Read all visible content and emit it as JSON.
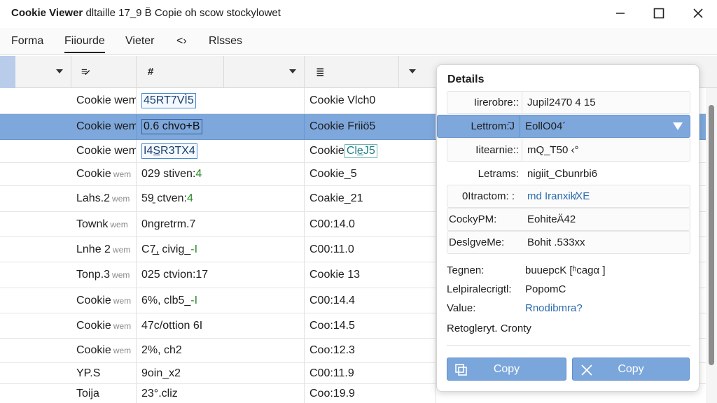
{
  "window": {
    "title_bold": "Cookie Viewer",
    "title_rest": " dltaille 17_9 B̈ Copie oh scow stockylowet"
  },
  "menu": [
    "Forma",
    "Fiiourde",
    "Vieter",
    "<›",
    "Rlsses"
  ],
  "grid": {
    "headers": [
      {
        "icon": "",
        "icon_name": "sort-caret-icon"
      },
      {
        "icon": "≡̷",
        "icon_name": "filter-icon"
      },
      {
        "icon": "#",
        "icon_name": "hash-icon"
      },
      {
        "icon": "≣",
        "icon_name": "funnel-icon"
      }
    ],
    "rows": [
      {
        "name": "Cookie wem",
        "name_sub": "",
        "value": "45RT7VÌ5",
        "value_style": "edit",
        "extra": "Cookie Vlch0",
        "extra_style": ""
      },
      {
        "name": "Cookie wem",
        "name_sub": "",
        "value": "0.6 chvo+B",
        "value_style": "edit",
        "extra": "Cookie Friiö5",
        "extra_style": "",
        "selected": true
      },
      {
        "name": "Cookie wem",
        "name_sub": "",
        "value": "I4S̲R3TX4",
        "value_style": "edit",
        "extra_prefix": "Cookie ",
        "extra": "Cle̲J5",
        "extra_style": "teal-hl"
      },
      {
        "name": "Cookie",
        "name_sub": "wem",
        "value_prefix": "029 stiven:",
        "value_suffix": "4",
        "value_style": "green-suffix",
        "extra": "Cookie_5",
        "extra_style": ""
      },
      {
        "name": "Lahs.2",
        "name_sub": "wem",
        "value_prefix": "59̱ ctven:",
        "value_suffix": "4",
        "value_style": "green-suffix",
        "extra": "Coakie_21",
        "extra_style": ""
      },
      {
        "name": "Townk",
        "name_sub": "wem",
        "value": "0ngretrm.7",
        "value_style": "",
        "extra": "C00:14.0",
        "extra_style": ""
      },
      {
        "name": "Lnhe 2",
        "name_sub": "wem",
        "value_prefix": "C7̲̲, civig_",
        "value_suffix": "-I",
        "value_style": "green-suffix",
        "extra": "C00:11.0",
        "extra_style": ""
      },
      {
        "name": "Tonp.3",
        "name_sub": "wem",
        "value": "025 ctvion:17",
        "value_style": "",
        "extra": "Cookie 13",
        "extra_style": ""
      },
      {
        "name": "Cookie",
        "name_sub": "wem",
        "value_prefix": "6%, clb5_",
        "value_suffix": "-I",
        "value_style": "green-suffix",
        "extra": "C00:14.4",
        "extra_style": ""
      },
      {
        "name": "Cookie",
        "name_sub": "wem",
        "value": "47c/ottion 6I",
        "value_style": "",
        "extra": "Coo:14.5",
        "extra_style": ""
      },
      {
        "name": "Cookie",
        "name_sub": "wem",
        "value": "2%, ch2",
        "value_style": "",
        "extra": "Coo:12.3",
        "extra_style": ""
      },
      {
        "name": "YP.S",
        "name_sub": "",
        "value": "9oin_x2",
        "value_style": "",
        "extra": "C00:11.9",
        "extra_style": ""
      },
      {
        "name": "Toija",
        "name_sub": "",
        "value": "23°.cliz",
        "value_style": "",
        "extra": "Coo:19.9",
        "extra_style": ""
      }
    ]
  },
  "details": {
    "title": "Details",
    "fields": [
      {
        "label": "Iirerobre::",
        "value": "Jupil247̄0 4 15",
        "value_blue_tail": "4 15"
      },
      {
        "label": "Lettrom:̄J",
        "value": "EollO04´",
        "selected": true
      },
      {
        "label": "Iitearnie::",
        "value": "mQ_̃T50 ‹°",
        "value_blue_tail": "‹°"
      },
      {
        "label": "Letrams:",
        "value": "nigiit_Cbunrbi6",
        "borderless": true
      },
      {
        "label": "0Itractom: :",
        "value": "md Iranxik̸XE",
        "blue": true
      },
      {
        "label": "CockyPM:",
        "value": "EohiteÄ42"
      },
      {
        "label": "DeslgveMe:",
        "value": "Bohit .533xx"
      }
    ],
    "plain": [
      {
        "label": "Tegnen:",
        "value": "buuepcK [ʰcagα ]"
      },
      {
        "label": "Lelpiralecrigtl:",
        "value": "PopomC"
      },
      {
        "label": "Value:",
        "value": "Rnodibmra?",
        "blue": true
      },
      {
        "label": "Retogleryt. Cronty",
        "value": ""
      }
    ],
    "buttons": [
      {
        "label": "Copy",
        "icon": "copy-icon"
      },
      {
        "label": "Copy",
        "icon": "close-icon"
      }
    ]
  },
  "colors": {
    "selection": "#7ea7dc",
    "accent_blue": "#2b6cae",
    "green": "#2a8a2a"
  }
}
